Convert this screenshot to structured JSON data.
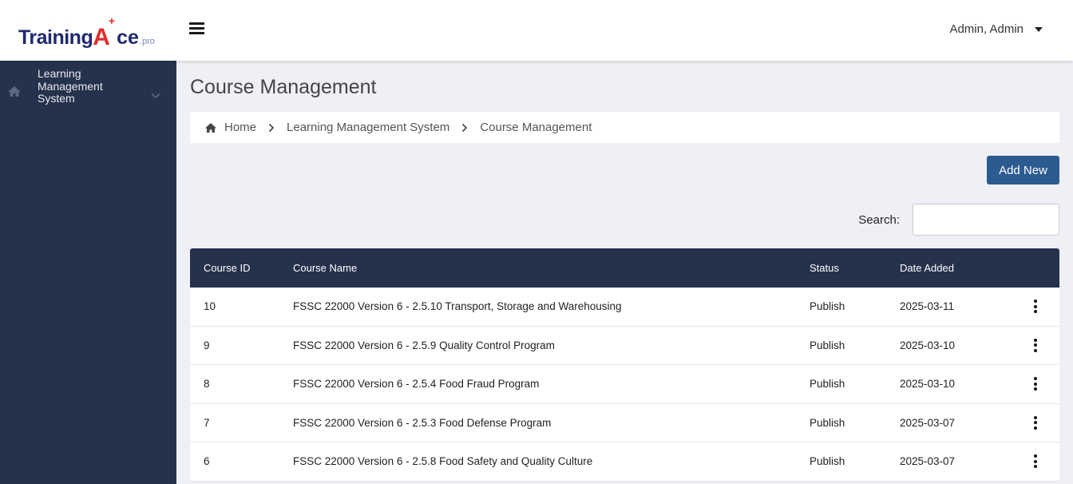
{
  "header": {
    "logo": {
      "part1": "Training",
      "part2": "A",
      "part2_sup": "+",
      "part3": "ce",
      "part4": ".pro"
    },
    "user_name": "Admin, Admin"
  },
  "sidebar": {
    "items": [
      {
        "label": "Learning Management System",
        "icon": "home-icon"
      }
    ]
  },
  "main": {
    "title": "Course Management",
    "breadcrumb": [
      "Home",
      "Learning Management System",
      "Course Management"
    ],
    "add_button": "Add New",
    "search_label": "Search:",
    "search_value": "",
    "table": {
      "columns": [
        "Course ID",
        "Course Name",
        "Status",
        "Date Added"
      ],
      "rows": [
        {
          "id": "10",
          "name": "FSSC 22000 Version 6 - 2.5.10 Transport, Storage and Warehousing",
          "status": "Publish",
          "date": "2025-03-11"
        },
        {
          "id": "9",
          "name": "FSSC 22000 Version 6 - 2.5.9 Quality Control Program",
          "status": "Publish",
          "date": "2025-03-10"
        },
        {
          "id": "8",
          "name": "FSSC 22000 Version 6 - 2.5.4 Food Fraud Program",
          "status": "Publish",
          "date": "2025-03-10"
        },
        {
          "id": "7",
          "name": "FSSC 22000 Version 6 - 2.5.3 Food Defense Program",
          "status": "Publish",
          "date": "2025-03-07"
        },
        {
          "id": "6",
          "name": "FSSC 22000 Version 6 - 2.5.8 Food Safety and Quality Culture",
          "status": "Publish",
          "date": "2025-03-07"
        }
      ]
    }
  },
  "colors": {
    "sidebar_bg": "#25324b",
    "table_header_bg": "#25324b",
    "primary_button": "#2c5b8f",
    "logo_blue": "#1f2a6e",
    "logo_red": "#e02a2a",
    "page_bg": "#eef0f5"
  }
}
